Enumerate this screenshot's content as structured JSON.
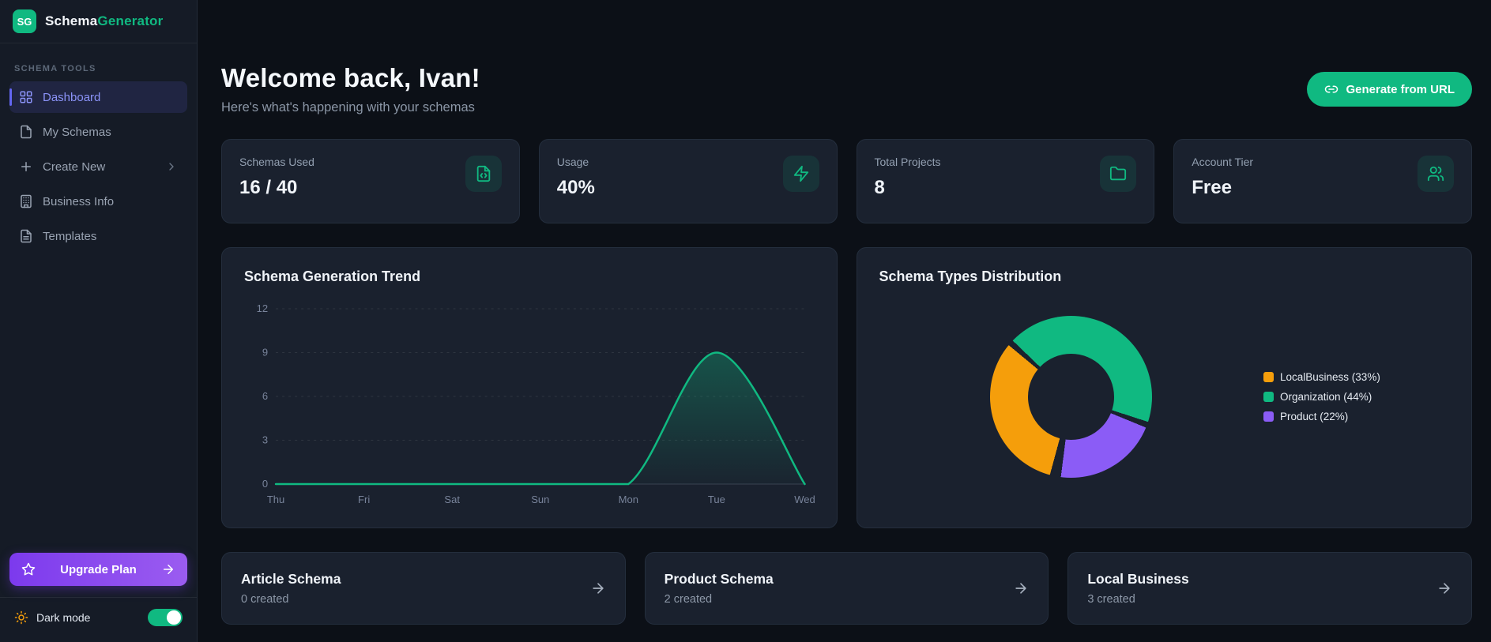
{
  "app": {
    "logo_text": "SG",
    "brand_part1": "Schema",
    "brand_part2": "Generator"
  },
  "colors": {
    "accent_green": "#10b981",
    "active_nav_purple": "#818cf8",
    "upgrade_purple": "#7c3aed",
    "orange": "#f59e0b",
    "purple": "#8b5cf6"
  },
  "sidebar": {
    "section_label": "SCHEMA TOOLS",
    "items": [
      {
        "label": "Dashboard",
        "icon": "grid",
        "active": true
      },
      {
        "label": "My Schemas",
        "icon": "file",
        "active": false
      },
      {
        "label": "Create New",
        "icon": "plus",
        "active": false,
        "chevron": "chevron-right"
      },
      {
        "label": "Business Info",
        "icon": "building",
        "active": false
      },
      {
        "label": "Templates",
        "icon": "file-text",
        "active": false
      }
    ],
    "upgrade": {
      "label": "Upgrade Plan",
      "icon": "star",
      "arrow_icon": "arrow-right"
    },
    "dark_mode": {
      "label": "Dark mode",
      "icon": "sun",
      "enabled": true
    }
  },
  "header": {
    "title": "Welcome back, Ivan!",
    "subtitle": "Here's what's happening with your schemas",
    "generate_button": {
      "label": "Generate from URL",
      "icon": "link"
    }
  },
  "stats": [
    {
      "label": "Schemas Used",
      "value": "16 / 40",
      "icon": "file-code"
    },
    {
      "label": "Usage",
      "value": "40%",
      "icon": "zap"
    },
    {
      "label": "Total Projects",
      "value": "8",
      "icon": "folder"
    },
    {
      "label": "Account Tier",
      "value": "Free",
      "icon": "users"
    }
  ],
  "chart_data": [
    {
      "type": "area",
      "title": "Schema Generation Trend",
      "categories": [
        "Thu",
        "Fri",
        "Sat",
        "Sun",
        "Mon",
        "Tue",
        "Wed"
      ],
      "values": [
        0,
        0,
        0,
        0,
        0,
        9,
        0
      ],
      "ylim": [
        0,
        12
      ],
      "yticks": [
        0,
        3,
        6,
        9,
        12
      ],
      "line_color": "#10b981",
      "grid": true,
      "legend_position": "none"
    },
    {
      "type": "donut",
      "title": "Schema Types Distribution",
      "start_angle": 193,
      "legend_position": "right",
      "segments": [
        {
          "label": "LocalBusiness",
          "pct": 33,
          "color": "#f59e0b"
        },
        {
          "label": "Organization",
          "pct": 44,
          "color": "#10b981"
        },
        {
          "label": "Product",
          "pct": 22,
          "color": "#8b5cf6"
        }
      ]
    }
  ],
  "quick_actions": [
    {
      "title": "Article Schema",
      "subtitle": "0 created",
      "icon": "arrow-right"
    },
    {
      "title": "Product Schema",
      "subtitle": "2 created",
      "icon": "arrow-right"
    },
    {
      "title": "Local Business",
      "subtitle": "3 created",
      "icon": "arrow-right"
    }
  ]
}
